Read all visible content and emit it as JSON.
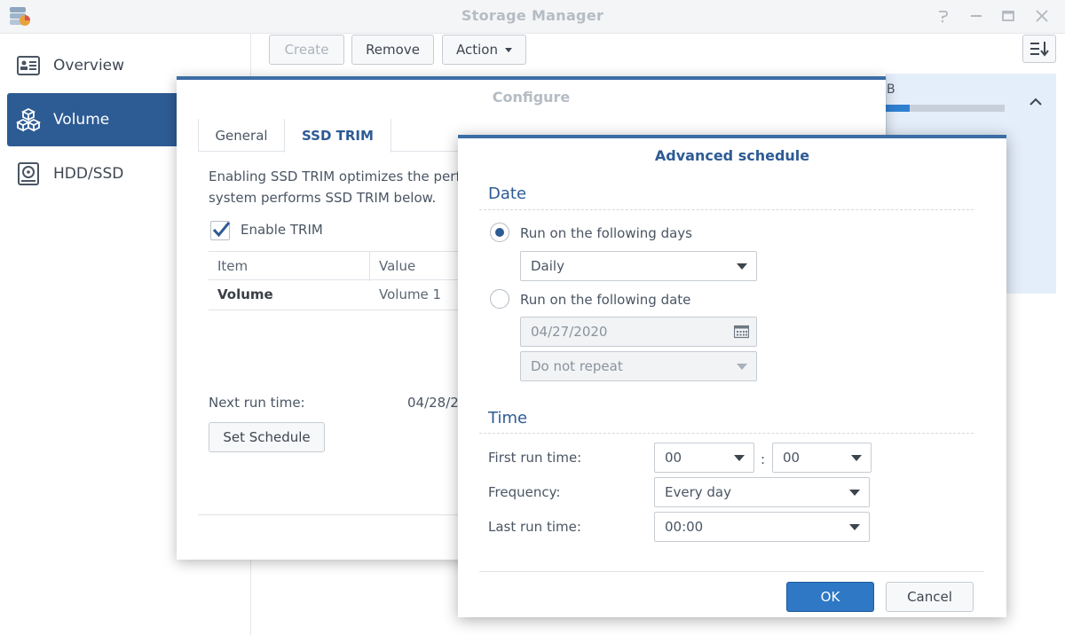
{
  "window": {
    "title": "Storage Manager",
    "controls": [
      "help-icon",
      "minimize-icon",
      "maximize-icon",
      "close-icon"
    ]
  },
  "sidebar": {
    "items": [
      {
        "label": "Overview",
        "icon": "overview-icon",
        "active": false
      },
      {
        "label": "Volume",
        "icon": "volume-icon",
        "active": true
      },
      {
        "label": "HDD/SSD",
        "icon": "hdd-icon",
        "active": false
      }
    ]
  },
  "toolbar": {
    "create_label": "Create",
    "remove_label": "Remove",
    "action_label": "Action"
  },
  "volume_panel": {
    "size_suffix": "B",
    "usage_fraction": 0.2
  },
  "configure_dialog": {
    "title": "Configure",
    "tabs": [
      {
        "label": "General",
        "active": false
      },
      {
        "label": "SSD TRIM",
        "active": true
      }
    ],
    "description_line1": "Enabling SSD TRIM optimizes the perfo",
    "description_line2": "system performs SSD TRIM below.",
    "enable_trim_label": "Enable TRIM",
    "enable_trim_checked": true,
    "table": {
      "headers": [
        "Item",
        "Value"
      ],
      "rows": [
        {
          "item": "Volume",
          "value": "Volume 1"
        }
      ]
    },
    "next_run_label": "Next run time:",
    "next_run_value": "04/28/2",
    "set_schedule_label": "Set Schedule"
  },
  "advanced_schedule": {
    "title": "Advanced schedule",
    "date_section": "Date",
    "option_days_label": "Run on the following days",
    "option_days_selected": true,
    "days_value": "Daily",
    "option_date_label": "Run on the following date",
    "date_value": "04/27/2020",
    "repeat_value": "Do not repeat",
    "time_section": "Time",
    "first_run_label": "First run time:",
    "first_run_hour": "00",
    "time_colon": ":",
    "first_run_minute": "00",
    "frequency_label": "Frequency:",
    "frequency_value": "Every day",
    "last_run_label": "Last run time:",
    "last_run_value": "00:00",
    "ok_label": "OK",
    "cancel_label": "Cancel"
  },
  "colors": {
    "accent": "#2d5b94",
    "primary_button": "#2e78c5",
    "sidebar_active": "#2d5b94",
    "panel_highlight": "#e4eefa",
    "title_gray": "#b5bcc4"
  }
}
